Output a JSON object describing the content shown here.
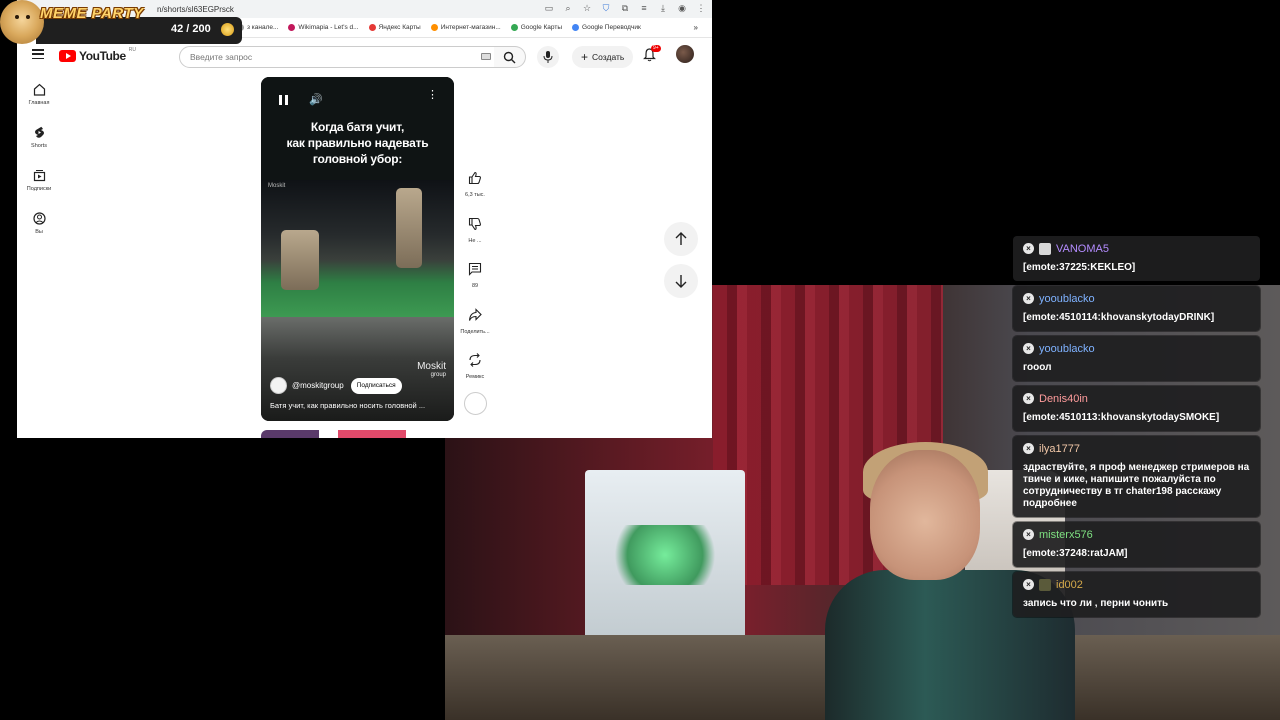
{
  "meme_widget": {
    "title": "MEME PARTY",
    "score": "42 / 200"
  },
  "browser": {
    "url_fragment": "n/shorts/sl63EGPrsck",
    "bookmarks": [
      {
        "label": "з канале...",
        "color": "#9e9e9e"
      },
      {
        "label": "Wikimapia - Let's d...",
        "color": "#c2185b"
      },
      {
        "label": "Яндекс Карты",
        "color": "#e53935"
      },
      {
        "label": "Интернет-магазин...",
        "color": "#ff8f00"
      },
      {
        "label": "Google Карты",
        "color": "#34a853"
      },
      {
        "label": "Google Переводчик",
        "color": "#4285f4"
      }
    ]
  },
  "youtube": {
    "logo_text": "YouTube",
    "logo_country": "RU",
    "search_placeholder": "Введите запрос",
    "create_label": "Создать",
    "notification_count": "9+",
    "sidebar": [
      {
        "label": "Главная",
        "icon": "home-icon"
      },
      {
        "label": "Shorts",
        "icon": "shorts-icon"
      },
      {
        "label": "Подписки",
        "icon": "subscriptions-icon"
      },
      {
        "label": "Вы",
        "icon": "you-icon"
      }
    ],
    "short": {
      "overlay_line1": "Когда батя учит,",
      "overlay_line2": "как правильно надевать",
      "overlay_line3": "головной убор:",
      "watermark": "Moskit",
      "brand_line1": "Moskit",
      "brand_line2": "group",
      "channel": "@moskitgroup",
      "subscribe_label": "Подписаться",
      "title": "Батя учит, как правильно носить головной ..."
    },
    "actions": [
      {
        "label": "6,3 тыс.",
        "icon": "like-icon"
      },
      {
        "label": "Не ...",
        "icon": "dislike-icon"
      },
      {
        "label": "89",
        "icon": "comments-icon"
      },
      {
        "label": "Поделить...",
        "icon": "share-icon"
      },
      {
        "label": "Ремикс",
        "icon": "remix-icon"
      }
    ]
  },
  "chat": [
    {
      "user": "VANOMA5",
      "color": "#b48cff",
      "badge": true,
      "text": "[emote:37225:KEKLEO]"
    },
    {
      "user": "yooublacko",
      "color": "#7fb2ff",
      "badge": false,
      "text": "[emote:4510114:khovanskytodayDRINK]"
    },
    {
      "user": "yooublacko",
      "color": "#7fb2ff",
      "badge": false,
      "text": "гооол"
    },
    {
      "user": "Denis40in",
      "color": "#ff9c9c",
      "badge": false,
      "text": "[emote:4510113:khovanskytodaySMOKE]"
    },
    {
      "user": "ilya1777",
      "color": "#f2c8a8",
      "badge": false,
      "text": "здраствуйте, я проф менеджер стримеров на твиче и кике, напишите пожалуйста по сотрудничеству в тг chater198 расскажу подробнее"
    },
    {
      "user": "misterx576",
      "color": "#7ee081",
      "badge": false,
      "text": "[emote:37248:ratJAM]"
    },
    {
      "user": "id002",
      "color": "#d4a94a",
      "badge": true,
      "text": "запись что ли , перни чонить"
    }
  ]
}
